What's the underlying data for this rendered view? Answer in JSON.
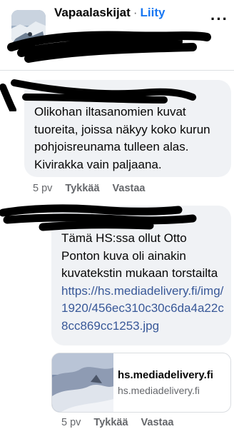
{
  "header": {
    "group_name": "Vapaalaskijat",
    "separator": "·",
    "join_label": "Liity",
    "more_label": "···"
  },
  "comments": [
    {
      "text": "Olikohan iltasanomien kuvat tuoreita, joissa näkyy koko kurun pohjoisreunama tulleen alas. Kivirakka vain paljaana.",
      "age": "5 pv",
      "like_label": "Tykkää",
      "reply_label": "Vastaa"
    },
    {
      "text_before_link": "Tämä HS:ssa ollut Otto Ponton kuva oli ainakin kuvatekstin mukaan torstailta ",
      "link_text": "https://hs.mediadelivery.fi/img/1920/456ec310c30c6da4a22c8cc869cc1253.jpg",
      "age": "5 pv",
      "like_label": "Tykkää",
      "reply_label": "Vastaa"
    }
  ],
  "link_preview": {
    "title": "hs.mediadelivery.fi",
    "domain": "hs.mediadelivery.fi"
  },
  "colors": {
    "link_blue": "#1877f2",
    "bubble_gray": "#f0f2f5",
    "meta_gray": "#65676b",
    "redaction": "#000000"
  }
}
